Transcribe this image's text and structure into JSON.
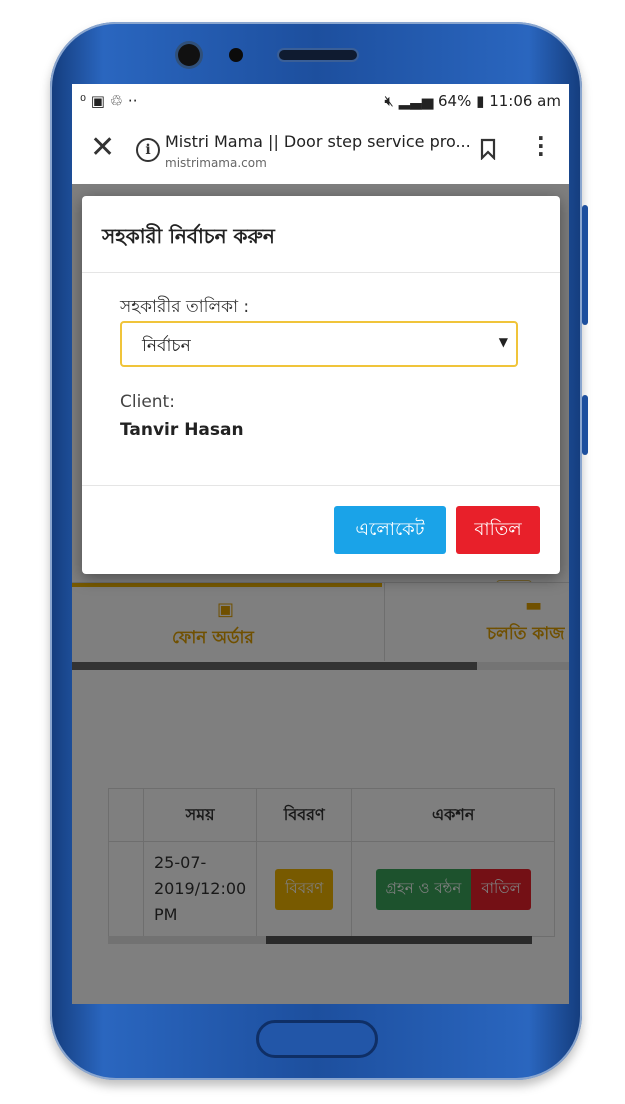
{
  "status_bar": {
    "left_icons": "⁰ ▣ ♲ ··",
    "battery": "64%",
    "time": "11:06 am"
  },
  "browser": {
    "page_title": "Mistri Mama || Door step service pro...",
    "host": "mistrimama.com"
  },
  "modal": {
    "title": "সহকারী নির্বাচন করুন",
    "field_label": "সহকারীর তালিকা :",
    "select_value": "নির্বাচন",
    "client_label": "Client:",
    "client_name": "Tanvir Hasan",
    "allocate_label": "এলোকেট",
    "cancel_label": "বাতিল"
  },
  "background_page": {
    "tabs": [
      {
        "label": "ফোন অর্ডার"
      },
      {
        "label": "চলতি কাজ"
      }
    ],
    "table": {
      "headers": [
        "সময়",
        "বিবরণ",
        "একশন"
      ],
      "rows": [
        {
          "time": "25-07-\n2019/12:00\nPM",
          "details_button": "বিবরণ",
          "accept_button": "গ্রহন ও বন্ঠন",
          "cancel_button": "বাতিল"
        }
      ]
    }
  },
  "colors": {
    "accent_yellow": "#f0b400",
    "allocate_blue": "#1aa3e8",
    "cancel_red": "#e8202a",
    "accept_green": "#3aa55a",
    "phone_blue": "#1d4f9e"
  }
}
